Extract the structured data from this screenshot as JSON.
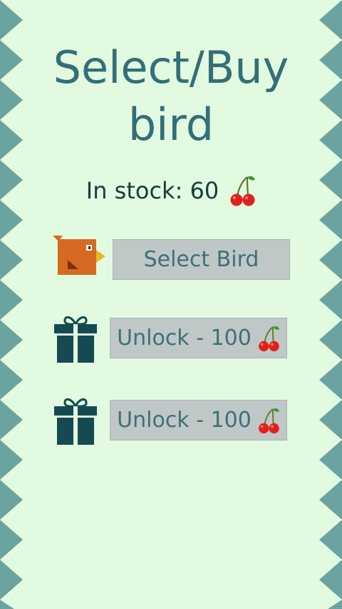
{
  "screen": {
    "title_line1": "Select/Buy",
    "title_line2": "bird",
    "stock_label": "In stock: 60"
  },
  "birds": [
    {
      "icon": "bird-icon",
      "action_label": "Select Bird",
      "price_icon": ""
    },
    {
      "icon": "gift-icon",
      "action_label": "Unlock - 100",
      "price_icon": "cherry-icon"
    },
    {
      "icon": "gift-icon",
      "action_label": "Unlock - 100",
      "price_icon": "cherry-icon"
    }
  ],
  "colors": {
    "background": "#e2fbe0",
    "spikes": "#6aa39f",
    "title": "#346e78",
    "button_bg": "#bfc8c6",
    "button_text": "#3f6f78",
    "gift": "#154a52",
    "bird_body": "#d66a22",
    "cherry": "#e0211b"
  }
}
